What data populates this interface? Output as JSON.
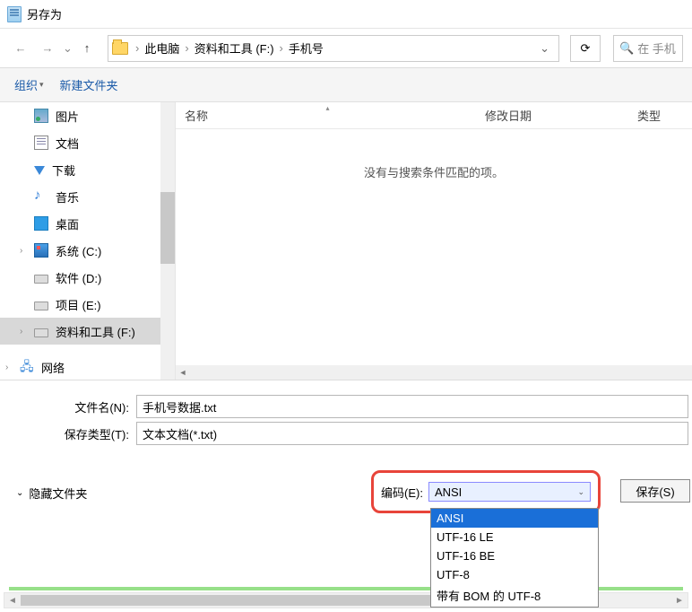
{
  "title": "另存为",
  "nav": {
    "back": "←",
    "fwd": "→",
    "up": "↑"
  },
  "breadcrumb": [
    "此电脑",
    "资料和工具 (F:)",
    "手机号"
  ],
  "refresh_glyph": "⟳",
  "search": {
    "icon": "🔍",
    "placeholder": "在 手机"
  },
  "toolbar": {
    "organize": "组织",
    "new_folder": "新建文件夹"
  },
  "sidebar": {
    "items": [
      {
        "label": "图片",
        "icon": "pic"
      },
      {
        "label": "文档",
        "icon": "doc"
      },
      {
        "label": "下载",
        "icon": "dl"
      },
      {
        "label": "音乐",
        "icon": "music"
      },
      {
        "label": "桌面",
        "icon": "desk"
      },
      {
        "label": "系统 (C:)",
        "icon": "sys",
        "expandable": true
      },
      {
        "label": "软件 (D:)",
        "icon": "drv"
      },
      {
        "label": "项目 (E:)",
        "icon": "drv"
      },
      {
        "label": "资料和工具 (F:)",
        "icon": "drv",
        "selected": true,
        "expandable": true
      }
    ],
    "network": "网络"
  },
  "columns": {
    "name": "名称",
    "date": "修改日期",
    "type": "类型"
  },
  "empty_text": "没有与搜索条件匹配的项。",
  "filename": {
    "label": "文件名(N):",
    "value": "手机号数据.txt"
  },
  "filetype": {
    "label": "保存类型(T):",
    "value": "文本文档(*.txt)"
  },
  "hide_folders": "隐藏文件夹",
  "encoding": {
    "label": "编码(E):",
    "value": "ANSI",
    "options": [
      "ANSI",
      "UTF-16 LE",
      "UTF-16 BE",
      "UTF-8",
      "带有 BOM 的 UTF-8"
    ]
  },
  "save_btn": "保存(S)"
}
